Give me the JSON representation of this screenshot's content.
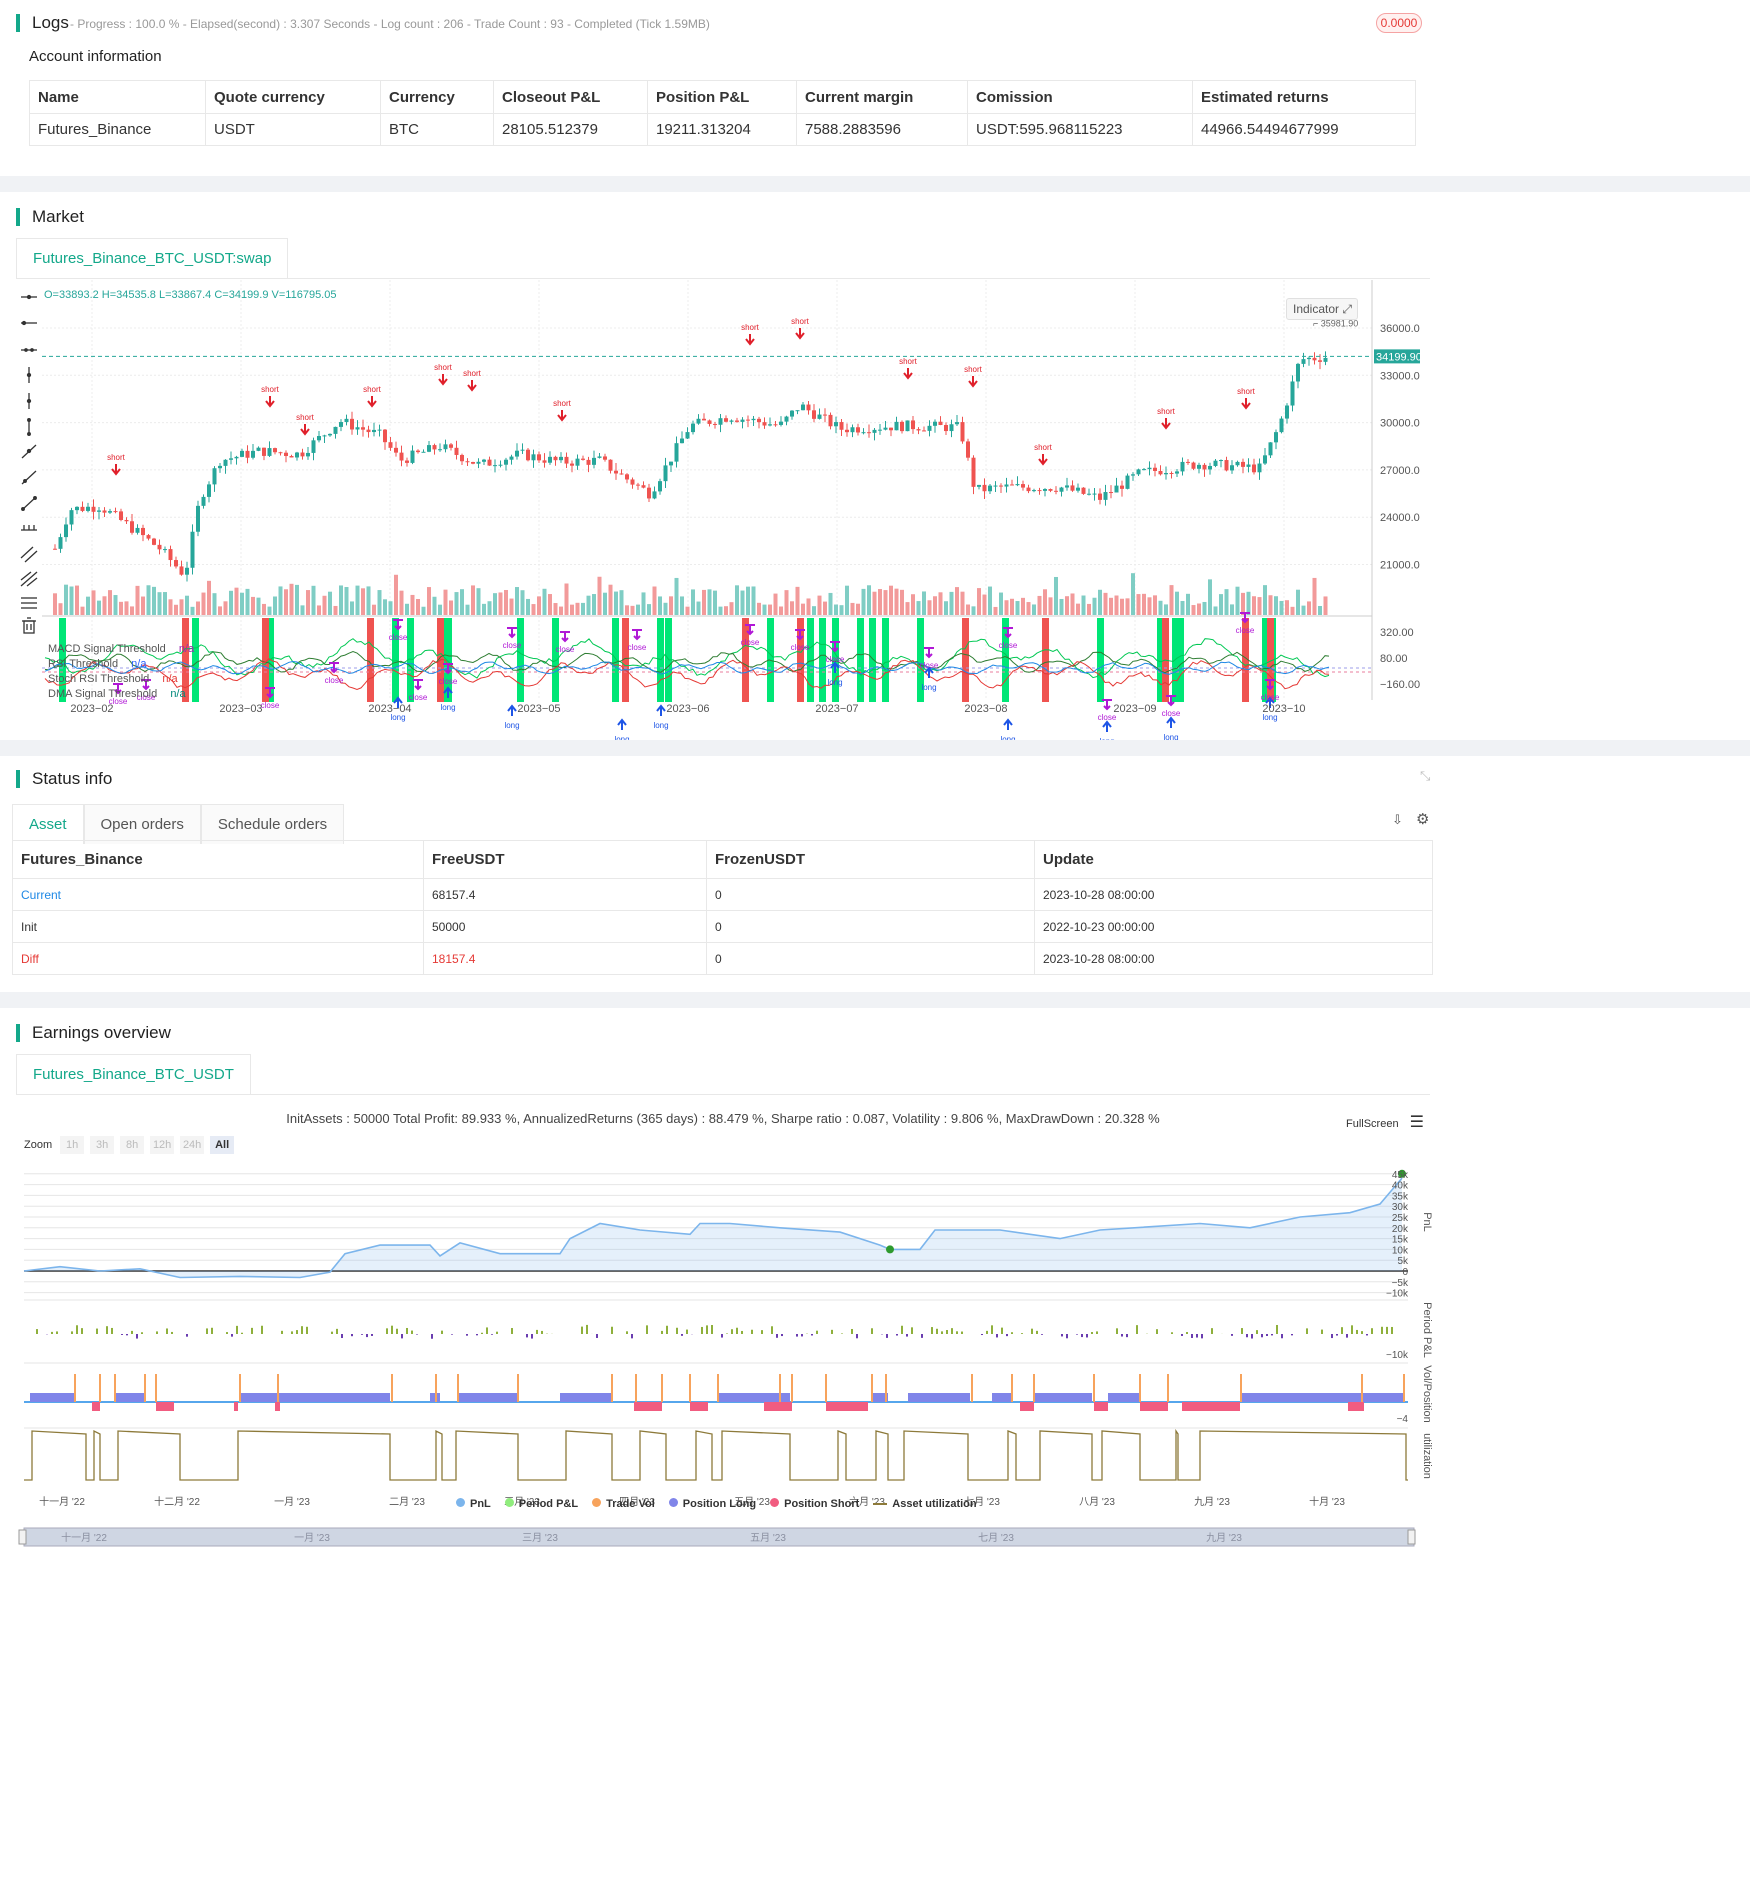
{
  "logs": {
    "title": "Logs",
    "status": "- Progress : 100.0 % - Elapsed(second) : 3.307 Seconds - Log count : 206 - Trade Count : 93 - Completed (Tick 1.59MB)",
    "badge": "0.0000"
  },
  "account": {
    "title": "Account information",
    "columns": [
      "Name",
      "Quote currency",
      "Currency",
      "Closeout P&L",
      "Position P&L",
      "Current margin",
      "Comission",
      "Estimated returns"
    ],
    "row": [
      "Futures_Binance",
      "USDT",
      "BTC",
      "28105.512379",
      "19211.313204",
      "7588.2883596",
      "USDT:595.968115223",
      "44966.54494677999"
    ]
  },
  "market": {
    "title": "Market",
    "tab": "Futures_Binance_BTC_USDT:swap",
    "ohlc": "O=33893.2 H=34535.8 L=33867.4 C=34199.9 V=116795.05",
    "indicator_button": "Indicator",
    "price_label": "34199.90",
    "high_label": "35981.90",
    "y_ticks": [
      "36000.00",
      "33000.00",
      "30000.00",
      "27000.00",
      "24000.00",
      "21000.00"
    ],
    "ind_ticks": [
      "320.00",
      "80.00",
      "−160.00"
    ],
    "x_ticks": [
      "2023−02",
      "2023−03",
      "2023−04",
      "2023−05",
      "2023−06",
      "2023−07",
      "2023−08",
      "2023−09",
      "2023−10"
    ],
    "legend": [
      {
        "name": "MACD Signal Threshold",
        "value": "n/a"
      },
      {
        "name": "RSI Threshold",
        "value": "n/a"
      },
      {
        "name": "Stoch RSI Threshold",
        "value": "n/a"
      },
      {
        "name": "DMA Signal Threshold",
        "value": "n/a"
      }
    ],
    "marker_words": {
      "short": "short",
      "long": "long",
      "close": "close"
    }
  },
  "status": {
    "title": "Status info",
    "tabs": [
      "Asset",
      "Open orders",
      "Schedule orders"
    ],
    "columns": [
      "Futures_Binance",
      "FreeUSDT",
      "FrozenUSDT",
      "Update"
    ],
    "rows": [
      [
        "Current",
        "68157.4",
        "0",
        "2023-10-28 08:00:00"
      ],
      [
        "Init",
        "50000",
        "0",
        "2022-10-23 00:00:00"
      ],
      [
        "Diff",
        "18157.4",
        "0",
        "2023-10-28 08:00:00"
      ]
    ]
  },
  "earnings": {
    "title": "Earnings overview",
    "tab": "Futures_Binance_BTC_USDT",
    "summary": "InitAssets : 50000 Total Profit: 89.933 %, AnnualizedReturns (365 days) : 88.479 %, Sharpe ratio : 0.087, Volatility : 9.806 %, MaxDrawDown : 20.328 %",
    "fullscreen": "FullScreen",
    "zoom_label": "Zoom",
    "zoom_options": [
      "1h",
      "3h",
      "8h",
      "12h",
      "24h",
      "All"
    ],
    "pnl_ticks": [
      "45k",
      "40k",
      "35k",
      "30k",
      "25k",
      "20k",
      "15k",
      "10k",
      "5k",
      "0",
      "−5k",
      "−10k"
    ],
    "period_tick": "−10k",
    "vol_tick": "−4",
    "axis_titles": [
      "PnL",
      "Period P&L",
      "Vol/Position",
      "utilization"
    ],
    "x_ticks": [
      "十一月 '22",
      "十二月 '22",
      "一月 '23",
      "二月 '23",
      "三月 '23",
      "四月 '23",
      "五月 '23",
      "六月 '23",
      "七月 '23",
      "八月 '23",
      "九月 '23",
      "十月 '23"
    ],
    "legend": [
      {
        "name": "PnL",
        "color": "#7cb5ec"
      },
      {
        "name": "Period P&L",
        "color": "#90ed7d"
      },
      {
        "name": "Trade Vol",
        "color": "#f7a35c"
      },
      {
        "name": "Position Long",
        "color": "#8085e9"
      },
      {
        "name": "Position Short",
        "color": "#f15c80"
      },
      {
        "name": "Asset utilization",
        "color": "#8d7a3a"
      }
    ],
    "navigator_ticks": [
      "十一月 '22",
      "一月 '23",
      "三月 '23",
      "五月 '23",
      "七月 '23",
      "九月 '23"
    ]
  },
  "colors": {
    "accent": "#13a88a",
    "up": "#26a69a",
    "down": "#ef5350",
    "long": "#1e55e6",
    "short": "#e0202b",
    "close": "#b018d6"
  }
}
